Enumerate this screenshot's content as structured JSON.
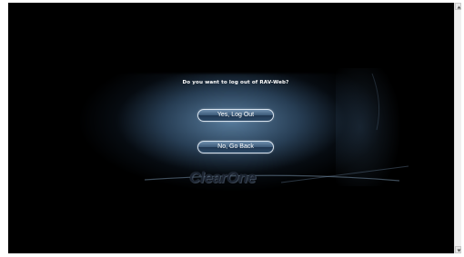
{
  "dialog": {
    "prompt": "Do you want to log out of RAV-Web?",
    "yes_label": "Yes, Log Out",
    "no_label": "No, Go Back"
  },
  "branding": {
    "logo_text": "ClearOne"
  },
  "colors": {
    "background": "#000000",
    "glow": "#5c82a5",
    "button_fill": "#3d5b7a",
    "button_border": "#d8e3ee",
    "text": "#ffffff"
  },
  "icons": {
    "scroll_up": "chevron-up-icon",
    "scroll_down": "chevron-down-icon"
  }
}
